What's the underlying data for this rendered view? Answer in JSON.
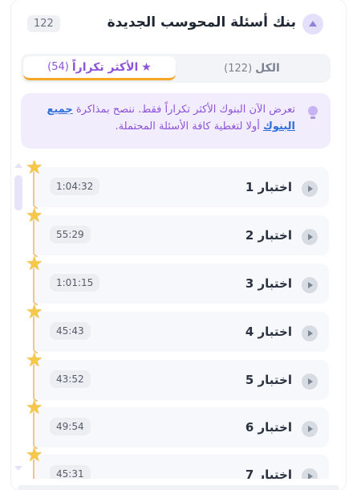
{
  "header": {
    "title": "بنك أسئلة المحوسب الجديدة",
    "count": "122"
  },
  "tabs": {
    "all": {
      "label": "الكل",
      "count": "(122)"
    },
    "frequent": {
      "label": "الأكثر تكراراً",
      "count": "(54)"
    }
  },
  "banner": {
    "text_before": "تعرض الآن البنوك الأكثر تكراراً فقط. ننصح بمذاكرة ",
    "link": "جميع البنوك",
    "text_after": " أولا لتغطية كافة الأسئلة المحتملة."
  },
  "tests": [
    {
      "label": "اختبار 1",
      "duration": "1:04:32"
    },
    {
      "label": "اختبار 2",
      "duration": "55:29"
    },
    {
      "label": "اختبار 3",
      "duration": "1:01:15"
    },
    {
      "label": "اختبار 4",
      "duration": "45:43"
    },
    {
      "label": "اختبار 5",
      "duration": "43:52"
    },
    {
      "label": "اختبار 6",
      "duration": "49:54"
    },
    {
      "label": "اختبار 7",
      "duration": "45:31"
    }
  ],
  "icons": {
    "collapse": "chevron-up-icon",
    "bulb": "lightbulb-icon",
    "play": "play-icon",
    "star": "star-icon"
  },
  "colors": {
    "accent_purple": "#8d54d9",
    "tab_underline": "#f5a623",
    "star": "#f5c84a",
    "link": "#2f6fd6",
    "banner_bg": "#f2edfd"
  }
}
